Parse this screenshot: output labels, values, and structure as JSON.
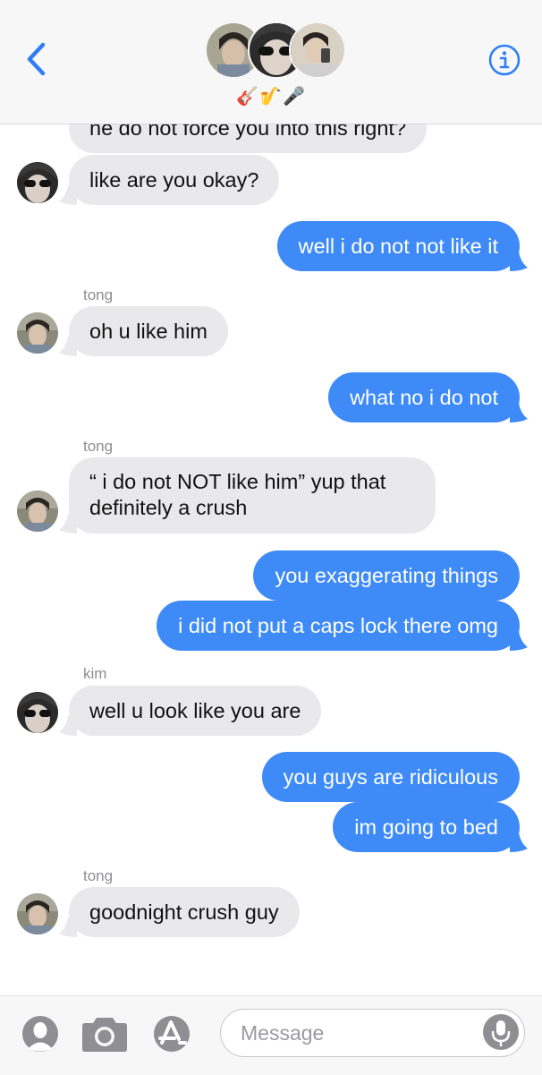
{
  "header": {
    "group_emoji": "🎸🎷🎤",
    "back_label": "Back",
    "info_label": "Info"
  },
  "thread": {
    "messages": [
      {
        "dir": "in",
        "text": "he do not force you into this right?"
      },
      {
        "dir": "in",
        "text": "like are you okay?"
      },
      {
        "dir": "out",
        "text": "well i do not not like it"
      },
      {
        "dir": "in",
        "sender": "tong",
        "text": "oh u like him"
      },
      {
        "dir": "out",
        "text": "what no i do not"
      },
      {
        "dir": "in",
        "sender": "tong",
        "text": "“ i do not NOT like him” yup that definitely a crush"
      },
      {
        "dir": "out",
        "text": "you exaggerating things"
      },
      {
        "dir": "out",
        "text": "i did not put a caps lock there omg"
      },
      {
        "dir": "in",
        "sender": "kim",
        "text": "well u look like you are"
      },
      {
        "dir": "out",
        "text": "you guys are ridiculous"
      },
      {
        "dir": "out",
        "text": "im going to bed"
      },
      {
        "dir": "in",
        "sender": "tong",
        "text": "goodnight crush guy"
      }
    ]
  },
  "composer": {
    "placeholder": "Message"
  },
  "colors": {
    "outgoing": "#3e8af7",
    "incoming": "#e9e9eb",
    "accent": "#2f7cf6"
  },
  "icons": [
    "back-chevron-icon",
    "info-icon",
    "memoji-icon",
    "camera-icon",
    "app-store-icon",
    "microphone-icon"
  ]
}
